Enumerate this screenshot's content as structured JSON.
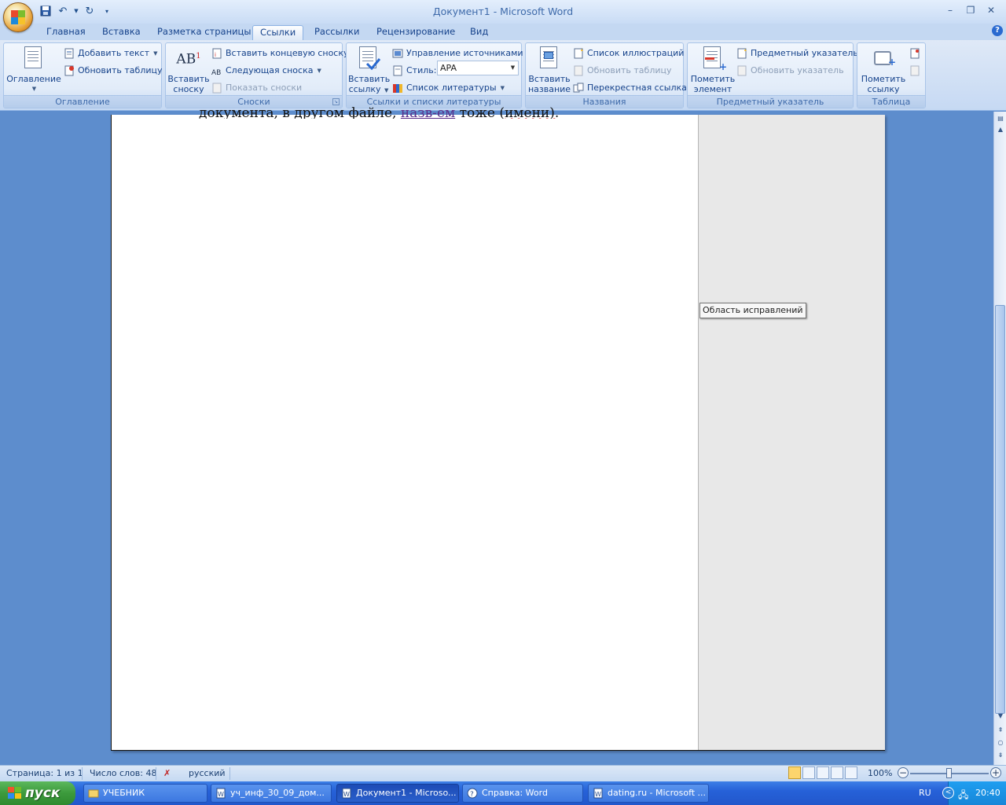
{
  "window": {
    "title": "Документ1 - Microsoft Word",
    "controls": [
      "minimize",
      "restore",
      "close"
    ]
  },
  "quick_access": [
    "save-icon",
    "undo-icon",
    "redo-icon",
    "customize-icon"
  ],
  "tabs": [
    {
      "label": "Главная"
    },
    {
      "label": "Вставка"
    },
    {
      "label": "Разметка страницы"
    },
    {
      "label": "Ссылки",
      "active": true
    },
    {
      "label": "Рассылки"
    },
    {
      "label": "Рецензирование"
    },
    {
      "label": "Вид"
    }
  ],
  "ribbon": {
    "toc": {
      "group_label": "Оглавление",
      "big_label": "Оглавление",
      "add_text": "Добавить текст",
      "update_table": "Обновить таблицу"
    },
    "footnotes": {
      "group_label": "Сноски",
      "big_label_1": "Вставить",
      "big_label_2": "сноску",
      "insert_endnote": "Вставить концевую сноску",
      "next_footnote": "Следующая сноска",
      "show_notes": "Показать сноски"
    },
    "citations": {
      "group_label": "Ссылки и списки литературы",
      "big_label_1": "Вставить",
      "big_label_2": "ссылку",
      "manage_sources": "Управление источниками",
      "style_label": "Стиль:",
      "style_value": "APA",
      "bibliography": "Список литературы"
    },
    "captions": {
      "group_label": "Названия",
      "big_label_1": "Вставить",
      "big_label_2": "название",
      "figures_list": "Список иллюстраций",
      "update_table": "Обновить таблицу",
      "cross_reference": "Перекрестная ссылка"
    },
    "index": {
      "group_label": "Предметный указатель",
      "big_label_1": "Пометить",
      "big_label_2": "элемент",
      "insert_index": "Предметный указатель",
      "update_index": "Обновить указатель"
    },
    "authorities": {
      "group_label": "Таблица ссылок",
      "big_label_1": "Пометить",
      "big_label_2": "ссылку"
    }
  },
  "document": {
    "text_before": "документа, в другом файле, ",
    "link_text": "назв-ем",
    "text_after": " тоже ",
    "squiggle_text": "(имени)."
  },
  "tooltip": "Область исправлений",
  "status": {
    "page": "Страница: 1 из 1",
    "words": "Число слов: 48",
    "language": "русский",
    "zoom": "100%",
    "zoom_fraction": 0.5
  },
  "taskbar": {
    "start": "пуск",
    "items": [
      {
        "label": "УЧЕБНИК",
        "icon": "folder-icon"
      },
      {
        "label": "уч_инф_30_09_дом...",
        "icon": "word-doc-icon"
      },
      {
        "label": "Документ1 - Microso...",
        "icon": "word-doc-icon",
        "active": true
      },
      {
        "label": "Справка: Word",
        "icon": "help-icon"
      },
      {
        "label": "dating.ru - Microsoft ...",
        "icon": "word-doc-icon"
      }
    ],
    "lang": "RU",
    "clock": "20:40"
  },
  "colors": {
    "ribbon_text": "#15428b",
    "workspace": "#5d8dcd",
    "taskbar": "#2661d8"
  }
}
